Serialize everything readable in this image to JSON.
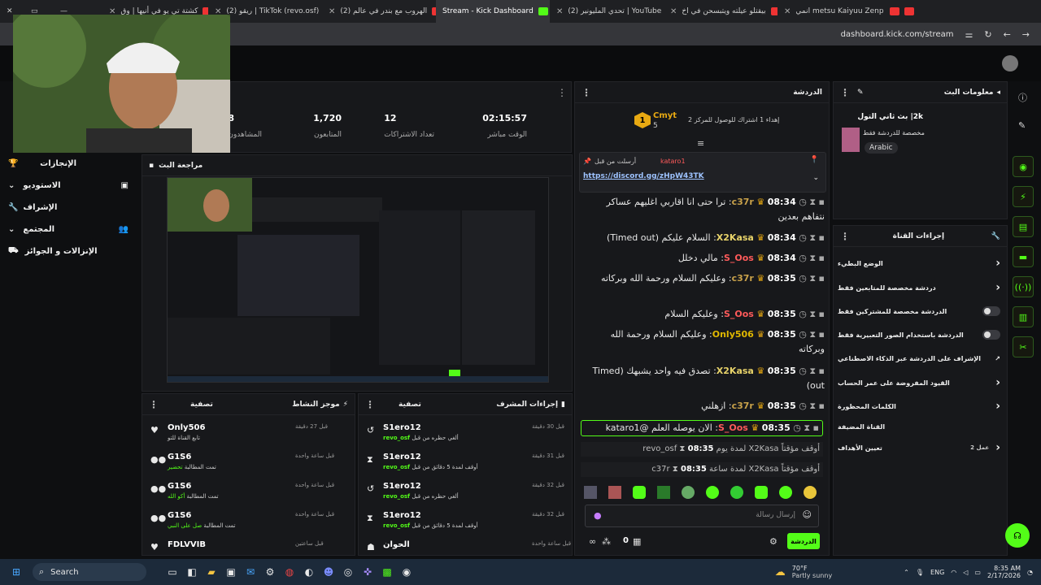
{
  "tabs": [
    "کشتة تي يو في أنيها | وق",
    "(2) ريقو | TikTok (revo.osf)",
    "(2) الهروب مع بندر في عالم",
    "Stream - Kick Dashboard",
    "(2) تحدي المليونير | YouTube",
    "بيقتلو عيلته ويتبسحن في اخ",
    "انمي metsu Kaiyuu Zenpen"
  ],
  "address": {
    "url": "dashboard.kick.com/stream"
  },
  "stats": [
    {
      "value": "02:15:57",
      "label": "الوقت مباشر"
    },
    {
      "value": "12",
      "label": "تعداد الاشتراكات"
    },
    {
      "value": "1,720",
      "label": "المتابعون"
    },
    {
      "value": "8",
      "label": "المشاهدون"
    }
  ],
  "nav": {
    "items": [
      "الإنجازات",
      "الاستوديو",
      "الإشراف",
      "المجتمع",
      "الإنزالات و الجوائز"
    ]
  },
  "preview": {
    "title": "مراجعة البث"
  },
  "feed": {
    "title": "موجز النشاط",
    "filter": "تصفية",
    "rows": [
      {
        "name": "Only506",
        "sub": "تابع القناة للتو",
        "time": "قبل 27 دقيقة"
      },
      {
        "name": "G1S6",
        "sub": "تحضير",
        "sub_pre": "تمت المطالبة",
        "time": "قبل ساعة واحدة"
      },
      {
        "name": "G1S6",
        "sub": "أكو الله",
        "sub_pre": "تمت المطالبة",
        "time": "قبل ساعة واحدة"
      },
      {
        "name": "G1S6",
        "sub": "صل على النبي",
        "sub_pre": "تمت المطالبة",
        "time": "قبل ساعة واحدة"
      },
      {
        "name": "FDLVVIB",
        "sub": "",
        "time": "قبل ساعتين"
      }
    ]
  },
  "modlog": {
    "title": "إجراءات المشرف",
    "filter": "تصفية",
    "rows": [
      {
        "name": "S1ero12",
        "sub": "ألغي حظره من قبل",
        "by": "revo_osf",
        "time": "قبل 30 دقيقة"
      },
      {
        "name": "S1ero12",
        "sub": "أوقف لمدة 5 دقائق من قبل",
        "by": "revo_osf",
        "time": "قبل 31 دقيقة"
      },
      {
        "name": "S1ero12",
        "sub": "ألغي حظره من قبل",
        "by": "revo_osf",
        "time": "قبل 32 دقيقة"
      },
      {
        "name": "S1ero12",
        "sub": "أوقف لمدة 5 دقائق من قبل",
        "by": "revo_osf",
        "time": "قبل 32 دقيقة"
      },
      {
        "name": "الحوان",
        "sub": "",
        "by": "",
        "time": "قبل ساعة واحدة"
      }
    ]
  },
  "chat": {
    "title": "الدردشة",
    "leader": {
      "rank": "1",
      "name": "Cmyt",
      "count": "5",
      "goal": "إهداء 1 اشتراك للوصول للمركز 2"
    },
    "pinned": {
      "label": "أرسلت من قبل",
      "user": "kataro1",
      "link": "https://discord.gg/zHpW43TK"
    },
    "messages": [
      {
        "time": "08:34",
        "user": "c37r",
        "text": "ترا حتى انا اقاربي اغليهم عساكر نتفاهم بعدين"
      },
      {
        "time": "08:34",
        "user": "X2Kasa",
        "text": "السلام عليكم (Timed out)"
      },
      {
        "time": "08:34",
        "user": "S_Oos",
        "text": "مالي دخلل"
      },
      {
        "time": "08:35",
        "user": "c37r",
        "text": "وعليكم السلام ورحمة الله وبركاته"
      },
      {
        "time": "08:35",
        "user": "S_Oos",
        "text": "وعليكم السلام"
      },
      {
        "time": "08:35",
        "user": "Only506",
        "text": "وعليكم السلام ورحمة الله وبركاته"
      },
      {
        "time": "08:35",
        "user": "X2Kasa",
        "text": "تصدق فيه واحد يشبهك (Timed out)"
      },
      {
        "time": "08:35",
        "user": "c37r",
        "text": "ازهلني"
      },
      {
        "time": "08:35",
        "user": "S_Oos",
        "text": "الان يوصله العلم @kataro1"
      }
    ],
    "system": [
      {
        "time": "08:35",
        "text": "أوقف مؤقتاً X2Kasa لمدة يوم revo_osf"
      },
      {
        "time": "08:35",
        "text": "أوقف مؤقتاً X2Kasa لمدة ساعة c37r"
      }
    ],
    "input_placeholder": "إرسال رسالة",
    "send_label": "الدردشة",
    "points": "0"
  },
  "info": {
    "title": "معلومات البث",
    "stream_title": "2k| بث ثاني التول",
    "category": "مخصصة للدردشة فقط",
    "language": "Arabic"
  },
  "actions": {
    "title": "إجراءات القناة",
    "items": [
      "الوضع البطيء",
      "دردشة مخصصة للمتابعين فقط",
      "الدردشة مخصصة للمشتركين فقط",
      "الدردشة باستخدام الصور التعبيرية فقط",
      "الإشراف على الدردشة عبر الذكاء الاصطناعي",
      "القيود المفروضة على عمر الحساب",
      "الكلمات المحظورة",
      "القناة المضيفة",
      "تعيين الأهداف"
    ],
    "goals_count": "عمل 2"
  },
  "taskbar": {
    "search": "Search",
    "weather_temp": "70°F",
    "weather_desc": "Partly sunny",
    "lang": "ENG",
    "time": "8:35 AM",
    "date": "2/17/2026"
  }
}
